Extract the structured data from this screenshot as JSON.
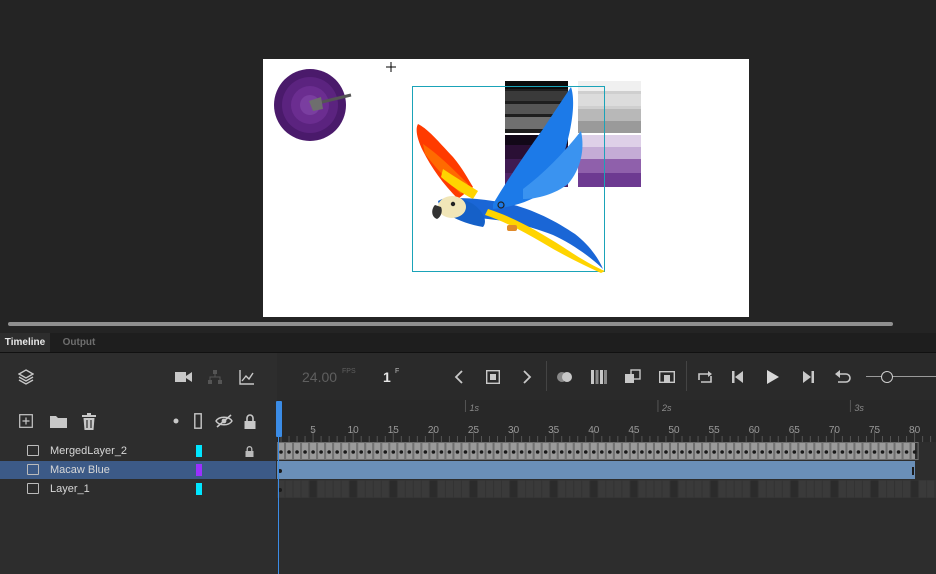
{
  "tabs": [
    {
      "label": "Timeline"
    },
    {
      "label": "Output"
    }
  ],
  "toolbar": {
    "fps_value": "24.00",
    "fps_unit": "FPS",
    "current_frame": "1",
    "frame_unit": "F"
  },
  "ruler": {
    "frame_labels": [
      "5",
      "10",
      "15",
      "20",
      "25",
      "30",
      "35",
      "40",
      "45",
      "50",
      "55",
      "60",
      "65",
      "70",
      "75",
      "80"
    ],
    "second_labels": [
      "1s",
      "2s",
      "3s"
    ]
  },
  "layers": [
    {
      "name": "MergedLayer_2",
      "color": "#00e5ff",
      "locked": true,
      "selected": false
    },
    {
      "name": "Macaw Blue",
      "color": "#9b30ff",
      "locked": false,
      "selected": true
    },
    {
      "name": "Layer_1",
      "color": "#00e5ff",
      "locked": false,
      "selected": false
    }
  ],
  "colors": {
    "selection": "#3c5a87",
    "playhead": "#3b8ce6",
    "bounding_box": "#1aa3b8"
  },
  "icons": [
    "layers-icon",
    "camera-icon",
    "parenting-icon",
    "graph-icon",
    "add-layer-icon",
    "folder-icon",
    "trash-icon",
    "dot-icon",
    "outline-icon",
    "eye-hide-icon",
    "lock-icon",
    "chevron-left-icon",
    "stop-icon",
    "chevron-right-icon",
    "onion-skin-icon",
    "onion-markers-icon",
    "edit-multiple-icon",
    "center-frame-icon",
    "loop-icon",
    "step-back-icon",
    "play-icon",
    "step-forward-icon",
    "undo-icon",
    "zoom-icon"
  ]
}
